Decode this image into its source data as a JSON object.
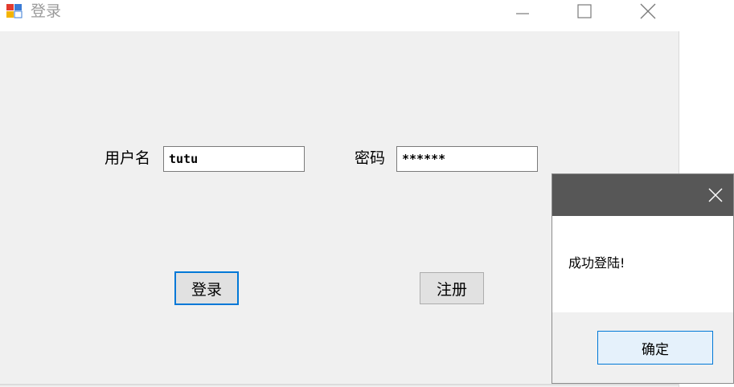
{
  "window": {
    "title": "登录",
    "controls": [
      "minimize-icon",
      "maximize-icon",
      "close-icon"
    ]
  },
  "form": {
    "username_label": "用户名",
    "username_value": "tutu",
    "password_label": "密码",
    "password_value": "******",
    "login_button": "登录",
    "register_button": "注册"
  },
  "message_box": {
    "text": "成功登陆!",
    "ok_button": "确定"
  },
  "colors": {
    "window_bg": "#f0f0f0",
    "focus_accent": "#0078d7",
    "dialog_titlebar": "#575757"
  }
}
